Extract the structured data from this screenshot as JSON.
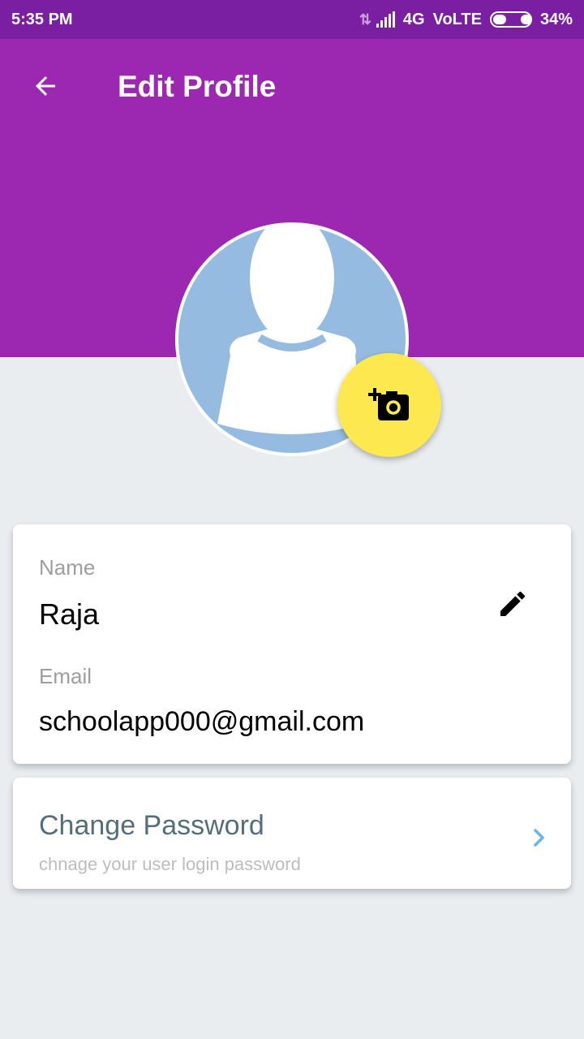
{
  "status_bar": {
    "time": "5:35 PM",
    "network": "4G",
    "volte": "VoLTE",
    "battery": "34%",
    "battery_level": 0.34
  },
  "header": {
    "title": "Edit Profile",
    "color": "#9c27b0",
    "back_icon": "arrow-back-icon"
  },
  "avatar": {
    "icon": "default-user-icon",
    "camera_icon": "add-a-photo-icon",
    "camera_color": "#fde94f"
  },
  "profile": {
    "name_label": "Name",
    "name_value": "Raja",
    "email_label": "Email",
    "email_value": "schoolapp000@gmail.com",
    "edit_icon": "pencil-icon"
  },
  "password": {
    "title": "Change Password",
    "subtitle": "chnage your user login password",
    "chevron_icon": "chevron-right-icon"
  }
}
